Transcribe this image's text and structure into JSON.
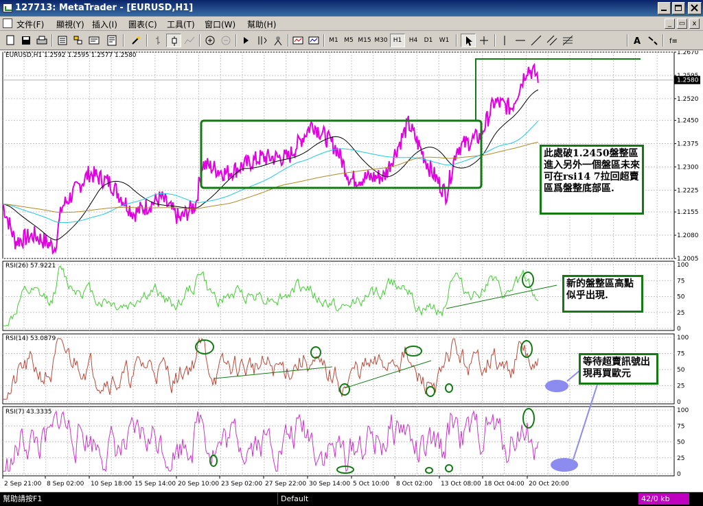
{
  "window": {
    "title": "127713: MetaTrader - [EURUSD,H1]",
    "buttons": [
      "minimize-icon",
      "restore-icon",
      "close-icon"
    ]
  },
  "menu": {
    "items": [
      "文件(F)",
      "顯視(Y)",
      "插入(I)",
      "圖表(C)",
      "工具(T)",
      "窗口(W)",
      "幫助(H)"
    ]
  },
  "toolbar": {
    "timeframes": [
      "M1",
      "M5",
      "M15",
      "M30",
      "H1",
      "H4",
      "D1",
      "W1"
    ],
    "active_timeframe": "H1",
    "icons": [
      "new-chart-icon",
      "save-icon",
      "print-icon",
      "market-watch-icon",
      "navigator-icon",
      "terminal-icon",
      "tester-icon",
      "expert-icon",
      "bar-chart-icon",
      "candle-chart-icon",
      "line-chart-icon",
      "zoom-in-icon",
      "zoom-out-icon",
      "autoscroll-icon",
      "chart-shift-icon",
      "indicators-icon",
      "templates-icon",
      "periods-icon",
      "cursor-icon",
      "crosshair-icon",
      "vertical-line-icon",
      "horizontal-line-icon",
      "trendline-icon",
      "channel-icon",
      "fibonacci-icon",
      "text-icon",
      "arrows-icon",
      "more-icon"
    ]
  },
  "chart": {
    "main_info": "EURUSD,H1  1.2592 1.2595 1.2577 1.2580",
    "current_price": "1.2580",
    "price_ticks": [
      "1.2670",
      "1.2595",
      "1.2520",
      "1.2450",
      "1.2375",
      "1.2300",
      "1.2225",
      "1.2155",
      "1.2080",
      "1.2005"
    ],
    "time_ticks": [
      "2 Sep 21:00",
      "8 Sep 02:00",
      "10 Sep 18:00",
      "15 Sep 14:00",
      "20 Sep 10:00",
      "23 Sep 02:00",
      "27 Sep 22:00",
      "30 Sep 14:00",
      "5 Oct 10:00",
      "8 Oct 02:00",
      "13 Oct 08:00",
      "18 Oct 04:00",
      "20 Oct 20:00"
    ],
    "indicators": [
      {
        "label": "RSI(26)  57.9221",
        "ticks": [
          "100",
          "75",
          "50",
          "25",
          "0"
        ]
      },
      {
        "label": "RSI(14)  53.0879",
        "ticks": [
          "100",
          "75",
          "50",
          "25",
          "0"
        ]
      },
      {
        "label": "RSI(7)  43.3335",
        "ticks": [
          "100",
          "75",
          "50",
          "25",
          "0"
        ]
      }
    ],
    "notes": {
      "note1": "此處破1.2450盤整區進入另外一個盤區未來可在rsi14 7拉回超賣區爲盤整底部區.",
      "note2": "新的盤整區高點似乎出現.",
      "note3": "等待超賣訊號出現再買歐元"
    },
    "colors": {
      "price": "#e000e0",
      "ma_fast": "#000000",
      "ma_mid": "#22c8e0",
      "ma_slow": "#b08a2a",
      "rsi26": "#44cc33",
      "rsi14": "#b84a3a",
      "rsi7": "#c835c8",
      "annotation": "#137a13",
      "marker": "#8b8bf0"
    }
  },
  "statusbar": {
    "help": "幫助請按F1",
    "profile": "Default",
    "traffic": "42/0 kb",
    "traffic_color": "#c000c0"
  }
}
